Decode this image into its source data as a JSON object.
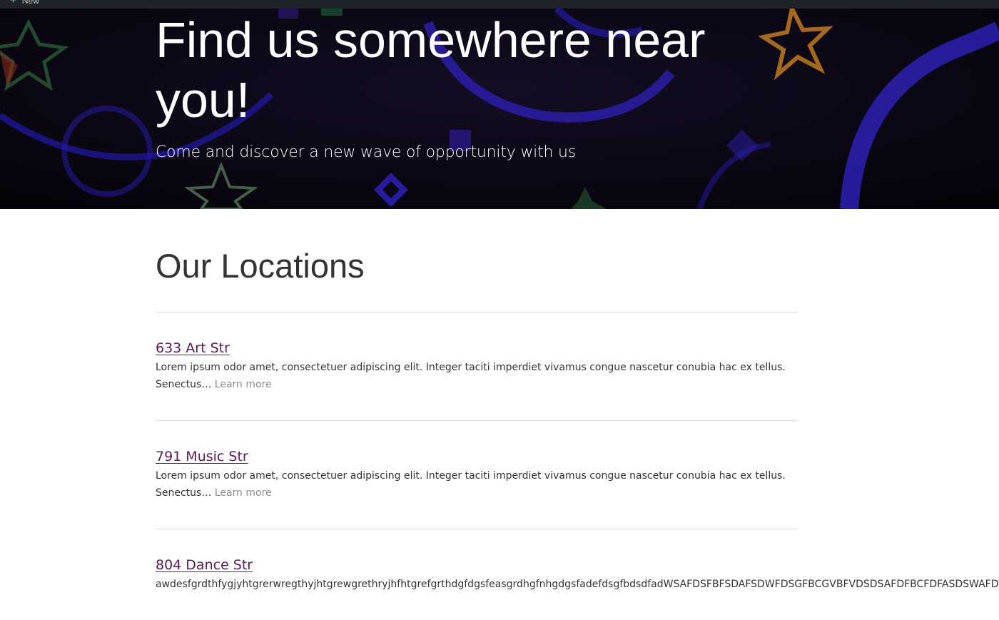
{
  "adminbar": {
    "new_label": "New",
    "icon": "plus-icon"
  },
  "hero": {
    "title": "Find us somewhere near you!",
    "subtitle": "Come and discover a new wave of opportunity with us"
  },
  "locations_section": {
    "title": "Our Locations",
    "items": [
      {
        "title": "633 Art Str",
        "excerpt": "Lorem ipsum odor amet, consectetuer adipiscing elit. Integer taciti imperdiet vivamus congue nascetur conubia hac ex tellus. Senectus…",
        "learn_more": "Learn more"
      },
      {
        "title": "791 Music Str",
        "excerpt": "Lorem ipsum odor amet, consectetuer adipiscing elit. Integer taciti imperdiet vivamus congue nascetur conubia hac ex tellus. Senectus…",
        "learn_more": "Learn more"
      },
      {
        "title": "804 Dance Str",
        "excerpt": "awdesfgrdthfygjyhtgrerwregthyjhtgrewgrethryjhfhtgrefgrthdgfdgsfeasgrdhgfnhgdgsfadefdsgfbdsdfadWSAFDSFBFSDAFSDWFDSGFBCGVBFVDSDSAFDFBCFDFASDSWAFDVFBCB"
      }
    ]
  },
  "colors": {
    "link": "#5b1a55",
    "learn_more": "#8c8c8c",
    "text": "#333333",
    "adminbar": "#1d2327"
  }
}
